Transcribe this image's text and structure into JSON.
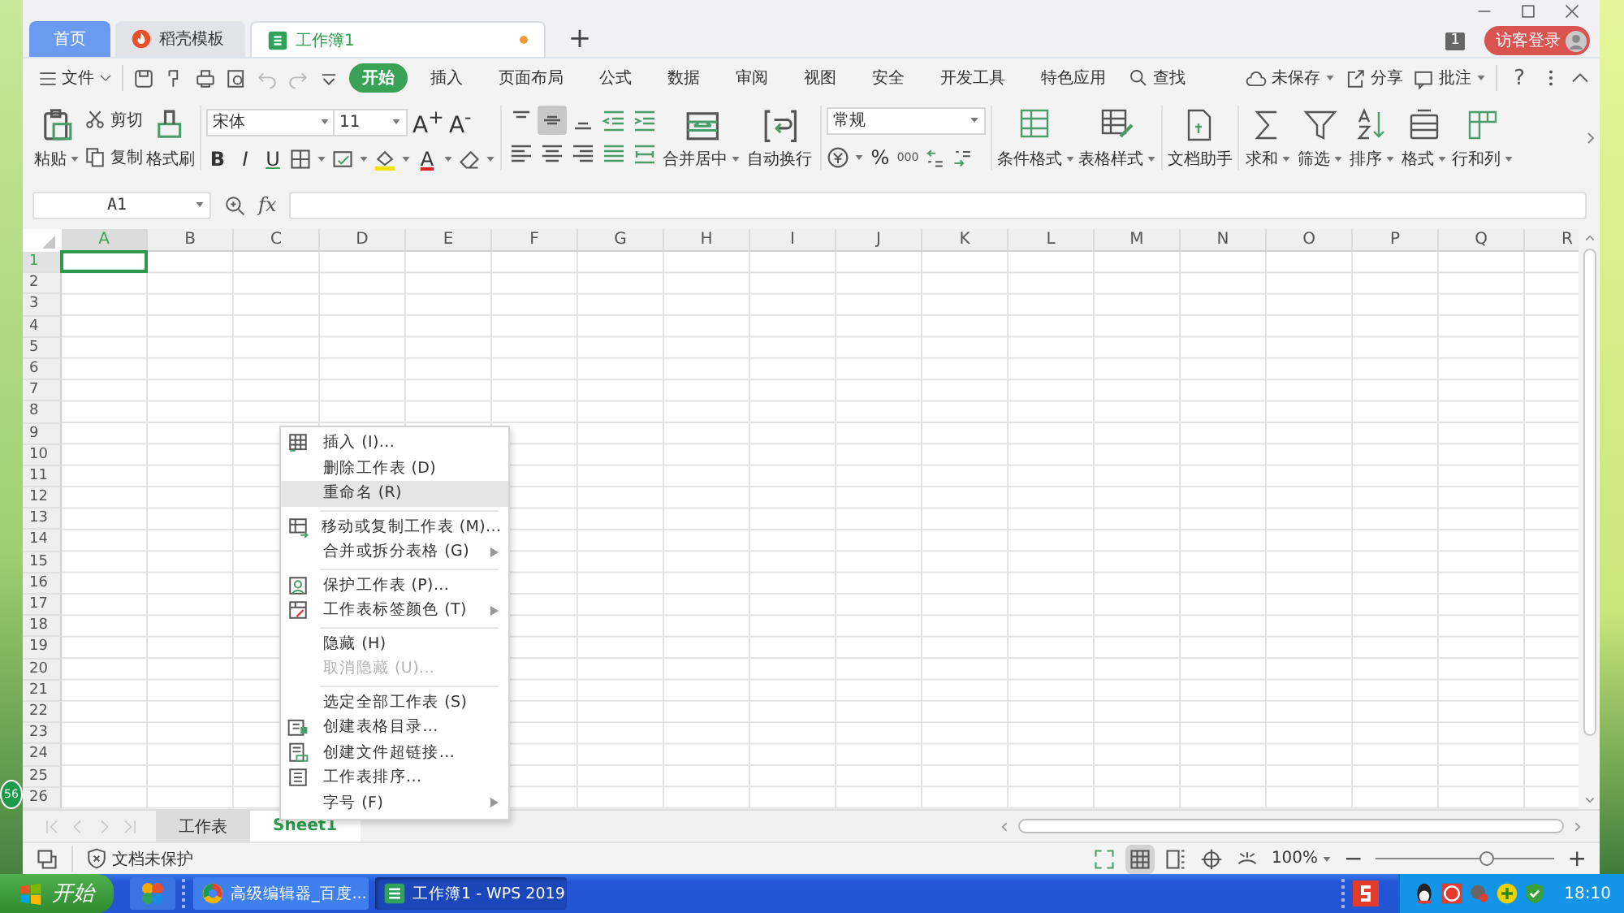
{
  "desktop": {
    "badge": "56"
  },
  "tabs": [
    {
      "label": "首页",
      "selected": false,
      "kind": "home"
    },
    {
      "label": "稻壳模板",
      "selected": false,
      "kind": "template"
    },
    {
      "label": "工作簿1",
      "selected": true,
      "kind": "workbook",
      "unsaved": true
    }
  ],
  "new_tab": "+",
  "window_count": "1",
  "login_button": "访客登录",
  "menu": {
    "file": "文件",
    "tabs": [
      {
        "label": "开始",
        "selected": true
      },
      {
        "label": "插入",
        "selected": false
      },
      {
        "label": "页面布局",
        "selected": false
      },
      {
        "label": "公式",
        "selected": false
      },
      {
        "label": "数据",
        "selected": false
      },
      {
        "label": "审阅",
        "selected": false
      },
      {
        "label": "视图",
        "selected": false
      },
      {
        "label": "安全",
        "selected": false
      },
      {
        "label": "开发工具",
        "selected": false
      },
      {
        "label": "特色应用",
        "selected": false
      }
    ],
    "search": "查找",
    "actions": [
      {
        "label": "未保存",
        "kind": "cloud",
        "dropdown": true
      },
      {
        "label": "分享",
        "kind": "share",
        "dropdown": false
      },
      {
        "label": "批注",
        "kind": "comment",
        "dropdown": true
      }
    ],
    "help": "?"
  },
  "ribbon": {
    "paste": "粘贴",
    "cut": "剪切",
    "copy": "复制",
    "format_painter": "格式刷",
    "font": "宋体",
    "font_size": "11",
    "grow": "A$^{+}$",
    "shrink": "A$^{-}$",
    "bold": "B",
    "italic": "I",
    "underline": "U",
    "font_color": "A",
    "align": [
      {
        "kind": "top",
        "selected": false
      },
      {
        "kind": "middle",
        "selected": true
      },
      {
        "kind": "bottom",
        "selected": false
      },
      {
        "kind": "outdent",
        "selected": false
      },
      {
        "kind": "indent",
        "selected": false
      },
      {
        "kind": "left",
        "selected": false
      },
      {
        "kind": "center",
        "selected": false
      },
      {
        "kind": "right",
        "selected": false
      },
      {
        "kind": "justify",
        "selected": false
      },
      {
        "kind": "distribute",
        "selected": false
      }
    ],
    "merge": "合并居中",
    "wrap": "自动换行",
    "number_format": "常规",
    "percent": "%",
    "thousands": "000",
    "big_buttons": [
      {
        "label": "条件格式",
        "kind": "conditional",
        "dropdown": true
      },
      {
        "label": "表格样式",
        "kind": "table-style",
        "dropdown": true
      },
      {
        "label": "文档助手",
        "kind": "assistant",
        "dropdown": false
      },
      {
        "label": "求和",
        "kind": "sum",
        "dropdown": true
      },
      {
        "label": "筛选",
        "kind": "filter",
        "dropdown": true
      },
      {
        "label": "排序",
        "kind": "sort",
        "dropdown": true
      },
      {
        "label": "格式",
        "kind": "format",
        "dropdown": true
      },
      {
        "label": "行和列",
        "kind": "rows-cols",
        "dropdown": true
      }
    ]
  },
  "formula_bar": {
    "name_box": "A1",
    "fx": "fx"
  },
  "grid": {
    "columns": [
      {
        "label": "A",
        "selected": true
      },
      {
        "label": "B",
        "selected": false
      },
      {
        "label": "C",
        "selected": false
      },
      {
        "label": "D",
        "selected": false
      },
      {
        "label": "E",
        "selected": false
      },
      {
        "label": "F",
        "selected": false
      },
      {
        "label": "G",
        "selected": false
      },
      {
        "label": "H",
        "selected": false
      },
      {
        "label": "I",
        "selected": false
      },
      {
        "label": "J",
        "selected": false
      },
      {
        "label": "K",
        "selected": false
      },
      {
        "label": "L",
        "selected": false
      },
      {
        "label": "M",
        "selected": false
      },
      {
        "label": "N",
        "selected": false
      },
      {
        "label": "O",
        "selected": false
      },
      {
        "label": "P",
        "selected": false
      },
      {
        "label": "Q",
        "selected": false
      },
      {
        "label": "R",
        "selected": false
      }
    ],
    "rows": [
      {
        "label": "1",
        "selected": true
      },
      {
        "label": "2",
        "selected": false
      },
      {
        "label": "3",
        "selected": false
      },
      {
        "label": "4",
        "selected": false
      },
      {
        "label": "5",
        "selected": false
      },
      {
        "label": "6",
        "selected": false
      },
      {
        "label": "7",
        "selected": false
      },
      {
        "label": "8",
        "selected": false
      },
      {
        "label": "9",
        "selected": false
      },
      {
        "label": "10",
        "selected": false
      },
      {
        "label": "11",
        "selected": false
      },
      {
        "label": "12",
        "selected": false
      },
      {
        "label": "13",
        "selected": false
      },
      {
        "label": "14",
        "selected": false
      },
      {
        "label": "15",
        "selected": false
      },
      {
        "label": "16",
        "selected": false
      },
      {
        "label": "17",
        "selected": false
      },
      {
        "label": "18",
        "selected": false
      },
      {
        "label": "19",
        "selected": false
      },
      {
        "label": "20",
        "selected": false
      },
      {
        "label": "21",
        "selected": false
      },
      {
        "label": "22",
        "selected": false
      },
      {
        "label": "23",
        "selected": false
      },
      {
        "label": "24",
        "selected": false
      },
      {
        "label": "25",
        "selected": false
      },
      {
        "label": "26",
        "selected": false
      }
    ]
  },
  "context_menu": [
    {
      "label": "插入 (I)...",
      "kind": "insert",
      "submenu": false,
      "disabled": false,
      "selected": false,
      "separator_before": false
    },
    {
      "label": "删除工作表 (D)",
      "kind": "plain",
      "submenu": false,
      "disabled": false,
      "selected": false,
      "separator_before": false
    },
    {
      "label": "重命名 (R)",
      "kind": "plain",
      "submenu": false,
      "disabled": false,
      "selected": true,
      "separator_before": false
    },
    {
      "label": "移动或复制工作表 (M)...",
      "kind": "move",
      "submenu": false,
      "disabled": false,
      "selected": false,
      "separator_before": true
    },
    {
      "label": "合并或拆分表格 (G)",
      "kind": "plain",
      "submenu": true,
      "disabled": false,
      "selected": false,
      "separator_before": false
    },
    {
      "label": "保护工作表 (P)...",
      "kind": "protect",
      "submenu": false,
      "disabled": false,
      "selected": false,
      "separator_before": true
    },
    {
      "label": "工作表标签颜色 (T)",
      "kind": "tab-color",
      "submenu": true,
      "disabled": false,
      "selected": false,
      "separator_before": false
    },
    {
      "label": "隐藏 (H)",
      "kind": "plain",
      "submenu": false,
      "disabled": false,
      "selected": false,
      "separator_before": true
    },
    {
      "label": "取消隐藏 (U)...",
      "kind": "plain",
      "submenu": false,
      "disabled": true,
      "selected": false,
      "separator_before": false
    },
    {
      "label": "选定全部工作表 (S)",
      "kind": "plain",
      "submenu": false,
      "disabled": false,
      "selected": false,
      "separator_before": true
    },
    {
      "label": "创建表格目录...",
      "kind": "catalog",
      "submenu": false,
      "disabled": false,
      "selected": false,
      "separator_before": false
    },
    {
      "label": "创建文件超链接...",
      "kind": "link",
      "submenu": false,
      "disabled": false,
      "selected": false,
      "separator_before": false
    },
    {
      "label": "工作表排序...",
      "kind": "sort",
      "submenu": false,
      "disabled": false,
      "selected": false,
      "separator_before": false
    },
    {
      "label": "字号 (F)",
      "kind": "plain",
      "submenu": true,
      "disabled": false,
      "selected": false,
      "separator_before": false
    }
  ],
  "sheet_tabs": [
    {
      "label": "工作表",
      "selected": false
    },
    {
      "label": "Sheet1",
      "selected": true
    }
  ],
  "status_bar": {
    "protection": "文档未保护",
    "views": [
      {
        "kind": "fullscreen",
        "selected": false
      },
      {
        "kind": "normal",
        "selected": true
      },
      {
        "kind": "page-break",
        "selected": false
      },
      {
        "kind": "reading",
        "selected": false
      }
    ],
    "zoom": "100%",
    "zoom_out": "−",
    "zoom_slider": {
      "level": 0.62
    },
    "zoom_in": "+"
  },
  "taskbar": {
    "start": "开始",
    "tasks": [
      {
        "label": "高级编辑器_百度...",
        "selected": false,
        "kind": "browser"
      },
      {
        "label": "工作簿1 - WPS 2019",
        "selected": true,
        "kind": "sheet"
      }
    ],
    "clock": "18:10"
  }
}
